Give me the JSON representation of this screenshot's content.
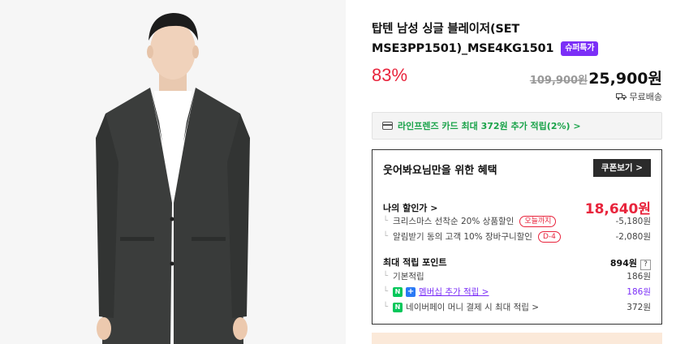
{
  "product": {
    "title": "탑텐 남성 싱글 블레이저(SET MSE3PP1501)_MSE4KG1501",
    "badge": "슈퍼특가",
    "discount_rate": "83%",
    "original_price": "109,900원",
    "sale_price": "25,900원",
    "shipping": "무료배송"
  },
  "card_promo": {
    "text": "라인프렌즈 카드 최대 372원 추가 적립(2%) >"
  },
  "benefits": {
    "title": "웃어봐요님만을 위한 혜택",
    "coupon_button": "쿠폰보기 >",
    "my_discount_label": "나의 할인가 >",
    "my_discount_value": "18,640원",
    "items": [
      {
        "label": "크리스마스 선착순 20% 상품할인",
        "tag": "오늘까지",
        "value": "-5,180원"
      },
      {
        "label": "알림받기 동의 고객 10% 장바구니할인",
        "tag": "D-4",
        "value": "-2,080원"
      }
    ],
    "points_label": "최대 적립 포인트",
    "points_value": "894원",
    "points_help": "?",
    "point_items": [
      {
        "label": "기본적립",
        "value": "186원"
      },
      {
        "label": "멤버십 추가 적립 >",
        "value": "186원"
      },
      {
        "label": "네이버페이 머니 결제 시 최대 적립 >",
        "value": "372원"
      }
    ],
    "naver_icon": "N",
    "plus_icon": "+"
  },
  "colors": {
    "accent_red": "#e8243c",
    "accent_purple": "#7b2ff7",
    "naver_green": "#03c75a"
  }
}
